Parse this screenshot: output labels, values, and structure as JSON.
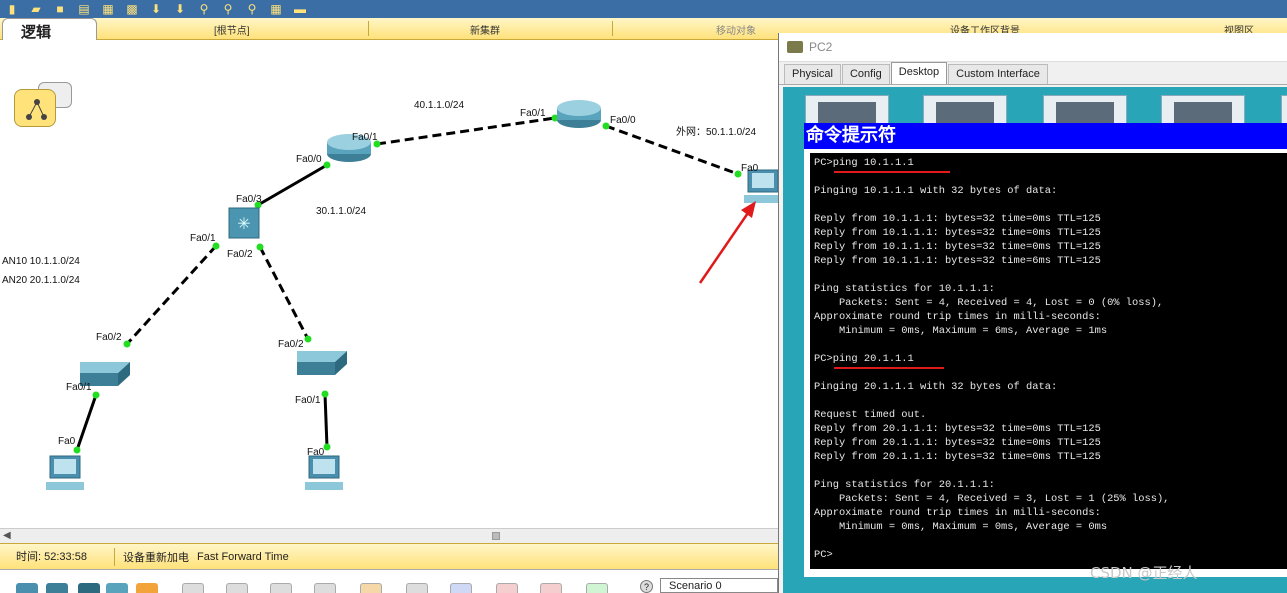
{
  "workspace": {
    "tab": "逻辑",
    "items": [
      "[根节点]",
      "新集群",
      "移动对象",
      "设备工作区背景",
      "视图区"
    ]
  },
  "topology": {
    "links": {
      "core_to_router": "40.1.1.0/24",
      "router_to_switch": "30.1.1.0/24",
      "external": "外网：50.1.1.0/24"
    },
    "vlans": [
      "AN10   10.1.1.0/24",
      "AN20   20.1.1.0/24"
    ],
    "ports": {
      "router_core_left": "Fa0/1",
      "router_core_right": "Fa0/0",
      "router_mid_right": "Fa0/1",
      "router_mid_left": "Fa0/0",
      "ml_switch_up": "Fa0/3",
      "ml_switch_left": "Fa0/1",
      "ml_switch_right": "Fa0/2",
      "sw1_up": "Fa0/2",
      "sw1_down": "Fa0/1",
      "pc1": "Fa0",
      "sw2_up": "Fa0/2",
      "sw2_down": "Fa0/1",
      "pc2_left": "Fa0",
      "pc_external": "Fa0"
    }
  },
  "status": {
    "time": "时间: 52:33:58",
    "power": "设备重新加电",
    "fast_forward": "Fast Forward Time"
  },
  "scenario": "Scenario 0",
  "pc_window": {
    "title": "PC2",
    "tabs": [
      "Physical",
      "Config",
      "Desktop",
      "Custom Interface"
    ],
    "active_tab": "Desktop",
    "cmd_title": "命令提示符",
    "lines": [
      "PC>ping 10.1.1.1",
      "",
      "Pinging 10.1.1.1 with 32 bytes of data:",
      "",
      "Reply from 10.1.1.1: bytes=32 time=0ms TTL=125",
      "Reply from 10.1.1.1: bytes=32 time=0ms TTL=125",
      "Reply from 10.1.1.1: bytes=32 time=0ms TTL=125",
      "Reply from 10.1.1.1: bytes=32 time=6ms TTL=125",
      "",
      "Ping statistics for 10.1.1.1:",
      "    Packets: Sent = 4, Received = 4, Lost = 0 (0% loss),",
      "Approximate round trip times in milli-seconds:",
      "    Minimum = 0ms, Maximum = 6ms, Average = 1ms",
      "",
      "PC>ping 20.1.1.1",
      "",
      "Pinging 20.1.1.1 with 32 bytes of data:",
      "",
      "Request timed out.",
      "Reply from 20.1.1.1: bytes=32 time=0ms TTL=125",
      "Reply from 20.1.1.1: bytes=32 time=0ms TTL=125",
      "Reply from 20.1.1.1: bytes=32 time=0ms TTL=125",
      "",
      "Ping statistics for 20.1.1.1:",
      "    Packets: Sent = 4, Received = 3, Lost = 1 (25% loss),",
      "Approximate round trip times in milli-seconds:",
      "    Minimum = 0ms, Maximum = 0ms, Average = 0ms",
      "",
      "PC>"
    ]
  },
  "watermark": "CSDN @正经人",
  "colors": {
    "yellow_bar": "#ffe27a",
    "desktop_bg": "#28a5b7",
    "cmd_title_bg": "#0000ff",
    "annotation_red": "#e01a1a",
    "link_ok": "#22dd22"
  }
}
